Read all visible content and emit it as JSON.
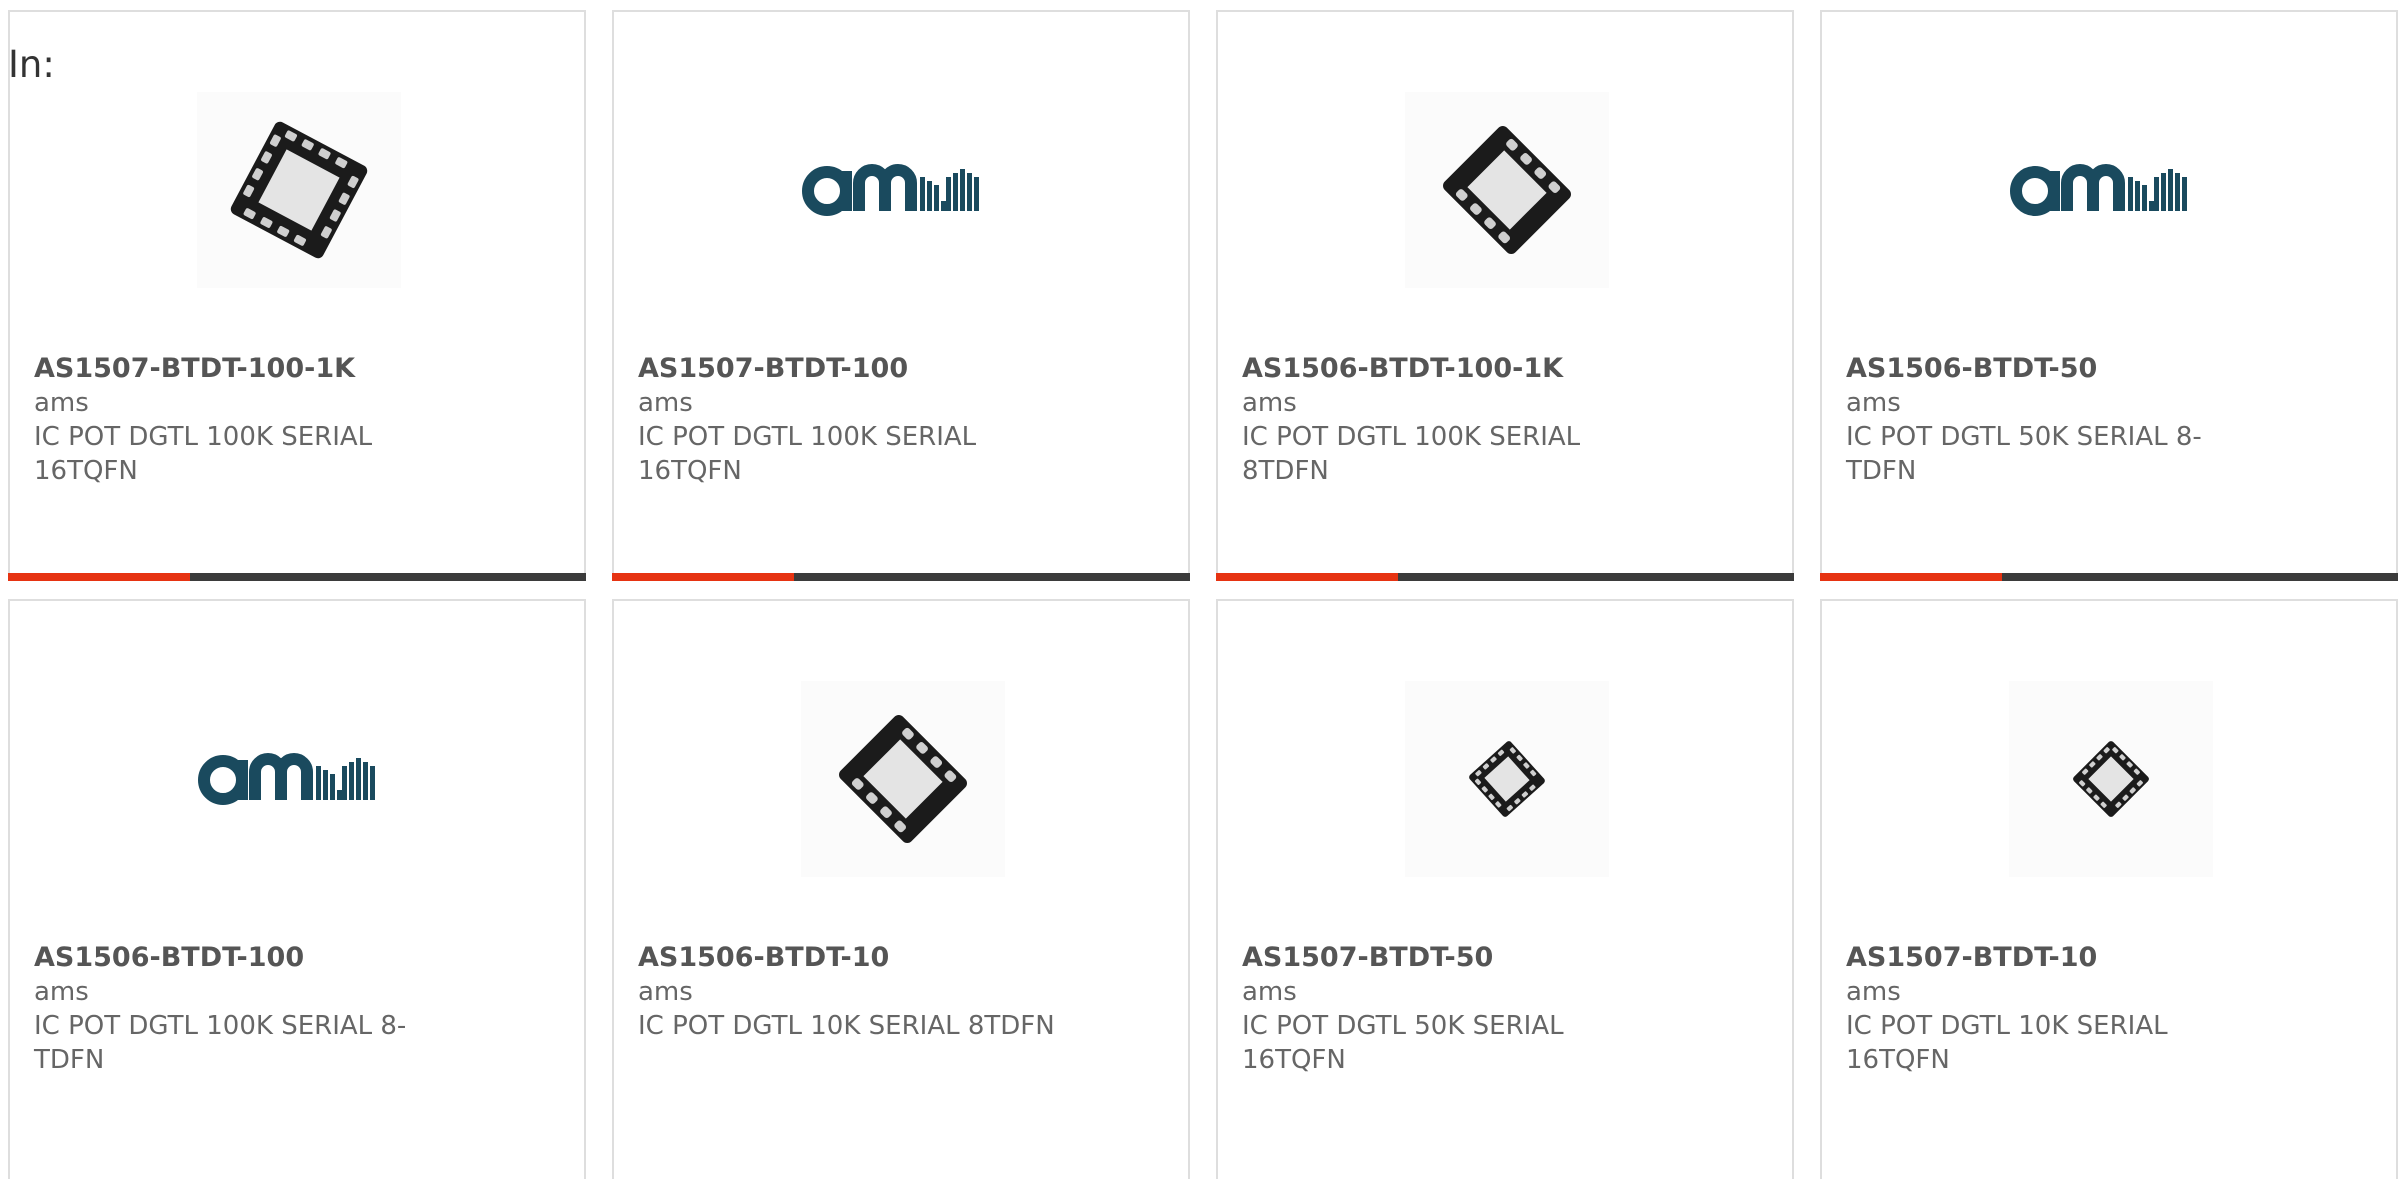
{
  "filter": {
    "label": "In:"
  },
  "products": [
    {
      "part_number": "AS1507-BTDT-100-1K",
      "manufacturer": "ams",
      "description": "IC POT DGTL 100K SERIAL 16TQFN",
      "image_icon": "qfn16-chip-icon",
      "progress": 0.315
    },
    {
      "part_number": "AS1507-BTDT-100",
      "manufacturer": "ams",
      "description": "IC POT DGTL 100K SERIAL 16TQFN",
      "image_icon": "ams-logo",
      "progress": 0.315
    },
    {
      "part_number": "AS1506-BTDT-100-1K",
      "manufacturer": "ams",
      "description": "IC POT DGTL 100K SERIAL 8TDFN",
      "image_icon": "dfn8-chip-icon",
      "progress": 0.315
    },
    {
      "part_number": "AS1506-BTDT-50",
      "manufacturer": "ams",
      "description": "IC POT DGTL 50K SERIAL 8-TDFN",
      "image_icon": "ams-logo",
      "progress": 0.315
    },
    {
      "part_number": "AS1506-BTDT-100",
      "manufacturer": "ams",
      "description": "IC POT DGTL 100K SERIAL 8-TDFN",
      "image_icon": "ams-logo"
    },
    {
      "part_number": "AS1506-BTDT-10",
      "manufacturer": "ams",
      "description": "IC POT DGTL 10K SERIAL 8TDFN",
      "image_icon": "dfn8-chip-icon"
    },
    {
      "part_number": "AS1507-BTDT-50",
      "manufacturer": "ams",
      "description": "IC POT DGTL 50K SERIAL 16TQFN",
      "image_icon": "qfn16-small-chip-icon"
    },
    {
      "part_number": "AS1507-BTDT-10",
      "manufacturer": "ams",
      "description": "IC POT DGTL 10K SERIAL 16TQFN",
      "image_icon": "qfn16-small-chip-icon"
    }
  ],
  "colors": {
    "accent": "#e63312",
    "track": "#3b3b3b",
    "logo": "#1a4a5e",
    "border": "#dedede",
    "text": "#666666"
  }
}
